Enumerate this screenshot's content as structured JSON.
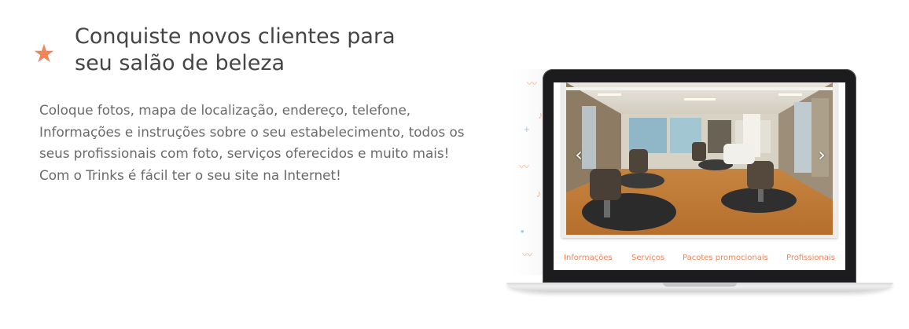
{
  "hero": {
    "icon": "star-icon",
    "accent_color": "#f0855a",
    "headline": "Conquiste novos clientes para seu salão de beleza",
    "description": "Coloque fotos, mapa de localização, endereço, telefone, Informações e instruções sobre o seu estabelecimento, todos os seus profissionais com foto, serviços oferecidos e muito mais! Com o Trinks é fácil ter o seu site na Internet!"
  },
  "site_preview": {
    "carousel": {
      "prev_icon": "chevron-left-icon",
      "next_icon": "chevron-right-icon"
    },
    "nav": [
      {
        "label": "Informações"
      },
      {
        "label": "Serviços"
      },
      {
        "label": "Pacotes promocionais"
      },
      {
        "label": "Profissionais"
      }
    ]
  }
}
